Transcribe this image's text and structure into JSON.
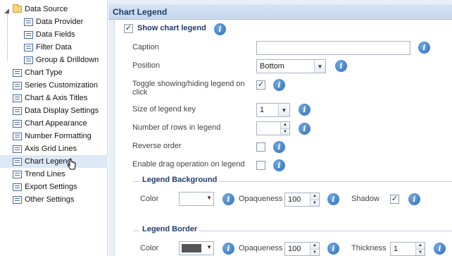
{
  "sidebar": {
    "items": [
      {
        "label": "Data Source",
        "icon": "folder-icon",
        "name": "sidebar-item-data-source"
      },
      {
        "label": "Data Provider",
        "icon": "page-icon",
        "name": "sidebar-item-data-provider"
      },
      {
        "label": "Data Fields",
        "icon": "page-icon",
        "name": "sidebar-item-data-fields"
      },
      {
        "label": "Filter Data",
        "icon": "page-icon",
        "name": "sidebar-item-filter-data"
      },
      {
        "label": "Group & Drilldown",
        "icon": "page-icon",
        "name": "sidebar-item-group-drilldown"
      },
      {
        "label": "Chart Type",
        "icon": "page-icon",
        "name": "sidebar-item-chart-type"
      },
      {
        "label": "Series Customization",
        "icon": "page-icon",
        "name": "sidebar-item-series-customization"
      },
      {
        "label": "Chart & Axis Titles",
        "icon": "page-icon",
        "name": "sidebar-item-chart-axis-titles"
      },
      {
        "label": "Data Display Settings",
        "icon": "page-icon",
        "name": "sidebar-item-data-display-settings"
      },
      {
        "label": "Chart Appearance",
        "icon": "page-icon",
        "name": "sidebar-item-chart-appearance"
      },
      {
        "label": "Number Formatting",
        "icon": "page-icon",
        "name": "sidebar-item-number-formatting"
      },
      {
        "label": "Axis Grid Lines",
        "icon": "page-icon",
        "name": "sidebar-item-axis-grid-lines"
      },
      {
        "label": "Chart Legend",
        "icon": "page-icon",
        "name": "sidebar-item-chart-legend",
        "selected": true
      },
      {
        "label": "Trend Lines",
        "icon": "page-icon",
        "name": "sidebar-item-trend-lines"
      },
      {
        "label": "Export Settings",
        "icon": "page-icon",
        "name": "sidebar-item-export-settings"
      },
      {
        "label": "Other Settings",
        "icon": "page-icon",
        "name": "sidebar-item-other-settings"
      }
    ]
  },
  "main": {
    "title": "Chart Legend",
    "show_legend": {
      "label": "Show chart legend",
      "checked": true
    },
    "fields": {
      "caption": {
        "label": "Caption",
        "value": ""
      },
      "position": {
        "label": "Position",
        "value": "Bottom"
      },
      "toggle": {
        "label_line1": "Toggle showing/hiding legend on",
        "label_line2": "click",
        "checked": true
      },
      "key_size": {
        "label": "Size of legend key",
        "value": "1"
      },
      "rows": {
        "label": "Number of rows in legend",
        "value": ""
      },
      "reverse": {
        "label": "Reverse order",
        "checked": false
      },
      "drag": {
        "label": "Enable drag operation on legend",
        "checked": false
      }
    },
    "background": {
      "title": "Legend Background",
      "color_label": "Color",
      "color_value": "#ffffff",
      "opaqueness_label": "Opaqueness",
      "opaqueness_value": "100",
      "shadow_label": "Shadow",
      "shadow_checked": true
    },
    "border": {
      "title": "Legend Border",
      "color_label": "Color",
      "color_value": "#555555",
      "opaqueness_label": "Opaqueness",
      "opaqueness_value": "100",
      "thickness_label": "Thickness",
      "thickness_value": "1"
    }
  },
  "icons": {
    "info": "i",
    "check": "✓",
    "dropdown": "▼",
    "spin_up": "▲",
    "spin_down": "▼"
  }
}
